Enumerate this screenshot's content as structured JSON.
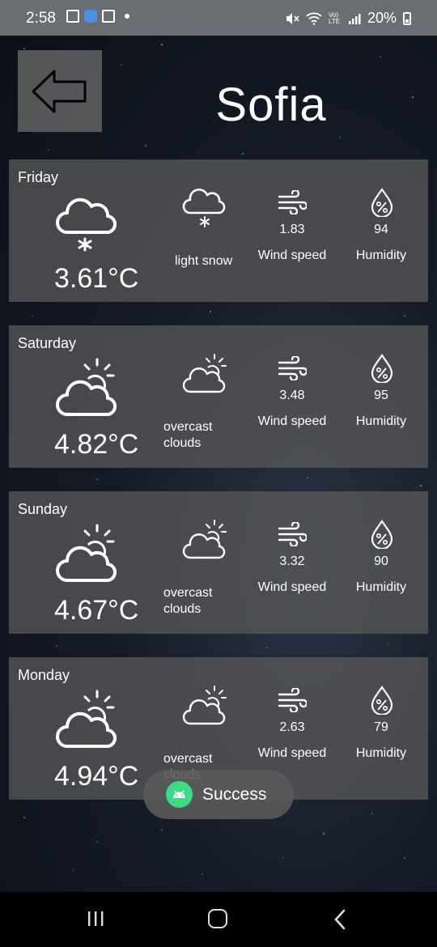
{
  "status_bar": {
    "time": "2:58",
    "battery": "20%",
    "signal_label": "Vo) LTE"
  },
  "header": {
    "city": "Sofia",
    "back_icon": "arrow-left-icon"
  },
  "forecast": [
    {
      "day": "Friday",
      "temp": "3.61°C",
      "condition": "light snow",
      "icon": "cloud-snow-icon",
      "wind_value": "1.83",
      "wind_label": "Wind speed",
      "humidity_value": "94",
      "humidity_label": "Humidity"
    },
    {
      "day": "Saturday",
      "temp": "4.82°C",
      "condition": "overcast clouds",
      "icon": "cloud-sun-icon",
      "wind_value": "3.48",
      "wind_label": "Wind speed",
      "humidity_value": "95",
      "humidity_label": "Humidity"
    },
    {
      "day": "Sunday",
      "temp": "4.67°C",
      "condition": "overcast clouds",
      "icon": "cloud-sun-icon",
      "wind_value": "3.32",
      "wind_label": "Wind speed",
      "humidity_value": "90",
      "humidity_label": "Humidity"
    },
    {
      "day": "Monday",
      "temp": "4.94°C",
      "condition": "overcast clouds",
      "icon": "cloud-sun-icon",
      "wind_value": "2.63",
      "wind_label": "Wind speed",
      "humidity_value": "79",
      "humidity_label": "Humidity"
    }
  ],
  "toast": {
    "text": "Success",
    "color": "#3ddc84"
  }
}
